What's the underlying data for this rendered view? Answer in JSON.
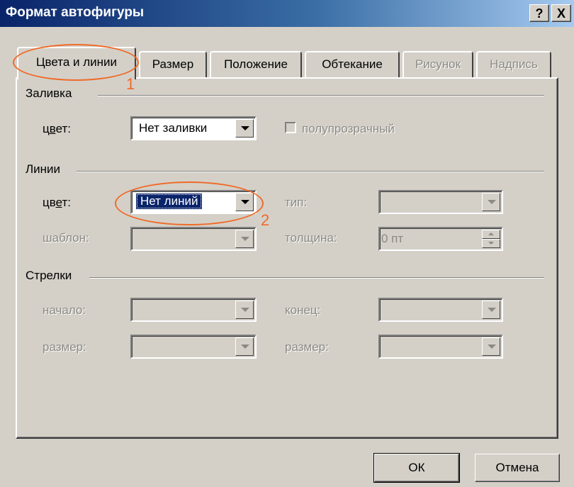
{
  "window": {
    "title": "Формат автофигуры",
    "help_button": "?",
    "close_button": "X"
  },
  "tabs": [
    {
      "label": "Цвета и линии",
      "state": "active"
    },
    {
      "label": "Размер",
      "state": "enabled"
    },
    {
      "label": "Положение",
      "state": "enabled"
    },
    {
      "label": "Обтекание",
      "state": "enabled"
    },
    {
      "label": "Рисунок",
      "state": "disabled"
    },
    {
      "label": "Надпись",
      "state": "disabled"
    }
  ],
  "fill": {
    "group_label": "Заливка",
    "color_label_pre": "ц",
    "color_label_u": "в",
    "color_label_post": "ет:",
    "color_value": "Нет заливки",
    "semitransparent_label": "полупрозрачный",
    "semitransparent_checked": false
  },
  "lines": {
    "group_label": "Линии",
    "color_label_pre": "цв",
    "color_label_u": "е",
    "color_label_post": "т:",
    "color_value": "Нет линий",
    "type_label": "тип:",
    "type_value": "",
    "pattern_label": "шаблон:",
    "pattern_value": "",
    "weight_label": "толщина:",
    "weight_value": "0 пт"
  },
  "arrows": {
    "group_label": "Стрелки",
    "begin_label": "начало:",
    "begin_value": "",
    "end_label": "конец:",
    "end_value": "",
    "begin_size_label": "размер:",
    "begin_size_value": "",
    "end_size_label": "размер:",
    "end_size_value": ""
  },
  "buttons": {
    "ok": "ОК",
    "cancel": "Отмена"
  },
  "annotations": {
    "marker_1": "1",
    "marker_2": "2",
    "color": "#f06a28"
  },
  "colors": {
    "title_bar_start": "#0a246a",
    "title_bar_end": "#a6caf0",
    "dialog_face": "#d4d0c8",
    "selection": "#0a246a",
    "disabled_text": "#8c8a85"
  }
}
